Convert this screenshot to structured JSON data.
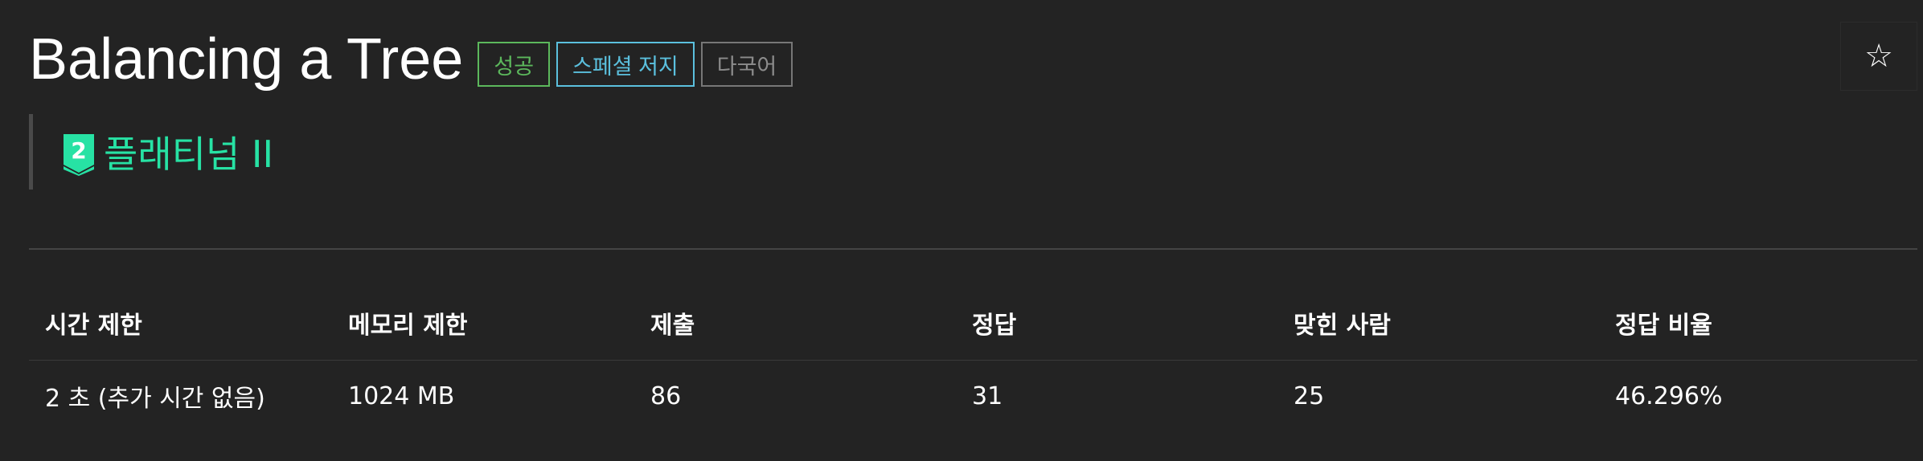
{
  "problem": {
    "title": "Balancing a Tree",
    "badges": {
      "success": "성공",
      "special_judge": "스페셜 저지",
      "multilingual": "다국어"
    },
    "favorite_icon": "star-outline-icon",
    "favorite_glyph": "☆"
  },
  "tier": {
    "icon": "platinum-tier-icon",
    "level_number": "2",
    "label": "플래티넘 II",
    "color": "#27e2a4"
  },
  "info_table": {
    "headers": {
      "time_limit": "시간 제한",
      "memory_limit": "메모리 제한",
      "submissions": "제출",
      "accepted": "정답",
      "solvers": "맞힌 사람",
      "ratio": "정답 비율"
    },
    "row": {
      "time_limit": "2 초 (추가 시간 없음)",
      "memory_limit": "1024 MB",
      "submissions": "86",
      "accepted": "31",
      "solvers": "25",
      "ratio": "46.296%"
    }
  },
  "colors": {
    "background": "#232323",
    "success": "#5cb85c",
    "special_judge": "#5bc0de",
    "multilingual": "#8c8c8c"
  }
}
